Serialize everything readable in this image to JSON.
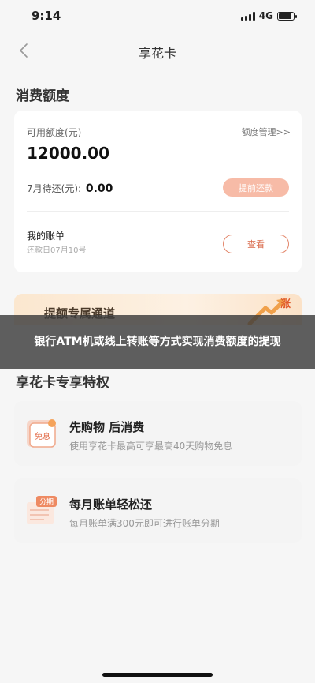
{
  "status_bar": {
    "time": "9:14",
    "network": "4G",
    "battery_level": 0.9
  },
  "nav": {
    "title": "享花卡",
    "back_icon": "chevron-left-icon"
  },
  "consumption": {
    "section_title": "消费额度",
    "available_label": "可用额度(元)",
    "available_amount": "12000.00",
    "quota_link": "额度管理>>",
    "pending_label": "7月待还(元):",
    "pending_amount": "0.00",
    "repay_button": "提前还款",
    "bill_title": "我的账单",
    "bill_due": "还款日07月10号",
    "view_button": "查看"
  },
  "promo": {
    "label": "提额专属通道",
    "badge": "涨",
    "accent": "#e05a2c"
  },
  "overlay": {
    "text": "银行ATM机或线上转账等方式实现消费额度的提现"
  },
  "benefits": {
    "section_title": "享花卡专享特权",
    "items": [
      {
        "title": "先购物 后消费",
        "desc": "使用享花卡最高可享最高40天购物免息",
        "icon": "free-interest-icon",
        "icon_text": "免息"
      },
      {
        "title": "每月账单轻松还",
        "desc": "每月账单满300元即可进行账单分期",
        "icon": "installment-icon",
        "icon_text": "分期"
      }
    ]
  },
  "colors": {
    "accent": "#e3866a",
    "repay_button": "#f7bba7",
    "background": "#f6f6f6"
  }
}
